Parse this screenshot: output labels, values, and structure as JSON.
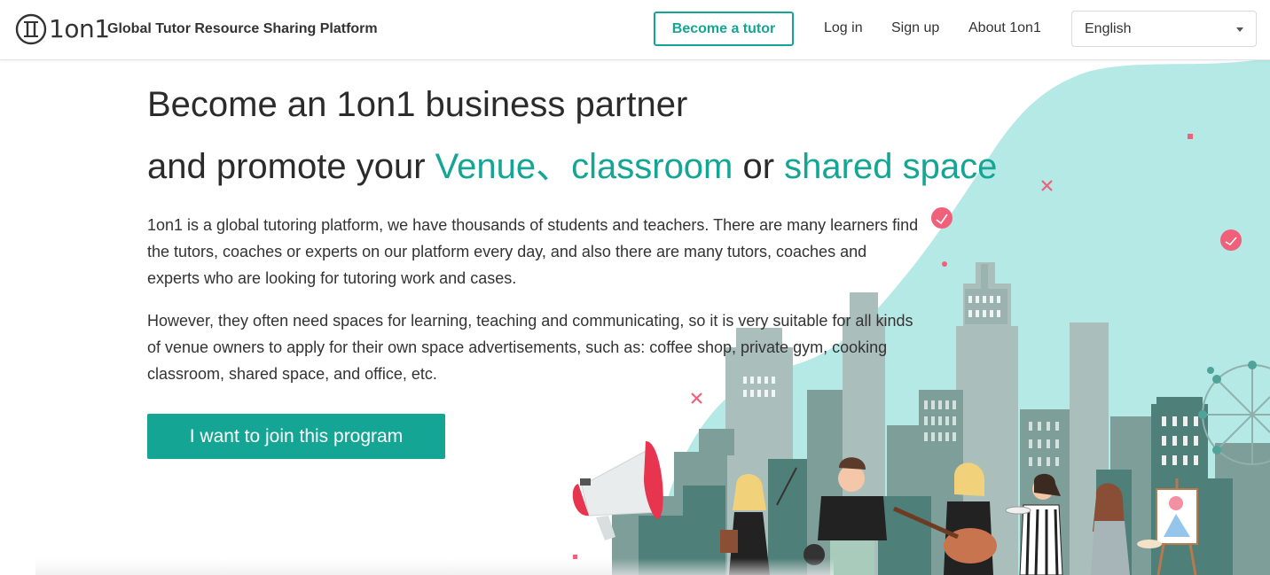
{
  "header": {
    "logo_text": "1on1",
    "tagline": "Global Tutor Resource Sharing Platform",
    "become_tutor_label": "Become a tutor",
    "nav": {
      "login": "Log in",
      "signup": "Sign up",
      "about": "About 1on1"
    },
    "language": {
      "selected": "English"
    }
  },
  "hero": {
    "headline_line1": "Become an 1on1 business partner",
    "headline_line2_prefix": "and promote your ",
    "highlight_venue": "Venue",
    "separator": "、",
    "highlight_classroom": "classroom",
    "conjunction": " or ",
    "highlight_shared_space": "shared space",
    "paragraph_1": "1on1 is a global tutoring platform, we have thousands of students and teachers. There are many learners find the tutors, coaches or experts on our platform every day, and also there are many tutors, coaches and experts who are looking for tutoring work and cases.",
    "paragraph_2": "However, they often need spaces for learning, teaching and communicating, so it is very suitable for all kinds of venue owners to apply for their own space advertisements, such as: coffee shop, private gym, cooking classroom, shared space, and office, etc.",
    "cta_label": "I want to join this program"
  },
  "colors": {
    "accent": "#14a594",
    "blob": "#b4e9e6",
    "city_light": "#a8bcb9",
    "city_mid": "#7e9f9b",
    "city_dark": "#4f7f78",
    "pink": "#f0607a",
    "text": "#333333"
  },
  "icons": {
    "logo": "1on1-logo-icon",
    "caret": "chevron-down-icon",
    "megaphone": "megaphone-icon"
  }
}
